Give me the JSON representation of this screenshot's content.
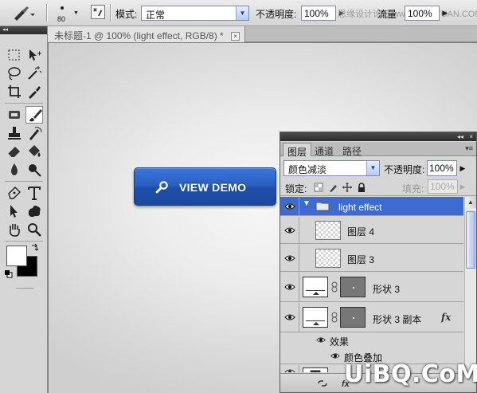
{
  "options_bar": {
    "brush_size": "80",
    "mode_label": "模式:",
    "mode_value": "正常",
    "opacity_label": "不透明度:",
    "opacity_value": "100%",
    "flow_label": "流量",
    "flow_value": "100%",
    "watermark_text": "思缘设计论坛 www.MISSYUAN.COM"
  },
  "toolbox": {
    "collapse_glyph": "◂◂",
    "tools": [
      "rectangular-marquee",
      "move",
      "lasso",
      "magic-wand",
      "crop",
      "eyedropper",
      "healing-brush",
      "brush",
      "clone-stamp",
      "history-brush",
      "eraser",
      "paint-bucket",
      "blur",
      "dodge",
      "pen",
      "type",
      "path-selection",
      "custom-shape",
      "hand",
      "zoom"
    ],
    "foreground_color": "#ffffff",
    "background_color": "#000000"
  },
  "document": {
    "tab_title": "未标题-1 @ 100% (light effect, RGB/8) *",
    "close_glyph": "×",
    "button_label": "VIEW DEMO",
    "button_color": "#2a5fc3"
  },
  "layers_panel": {
    "tabs": [
      "图层",
      "通道",
      "路径"
    ],
    "collapse_glyph": "◂◂",
    "close_glyph": "×",
    "menu_glyph": "▾≡",
    "blend_mode": "颜色减淡",
    "opacity_label": "不透明度:",
    "opacity_value": "100%",
    "lock_label": "锁定:",
    "fill_label": "填充:",
    "fill_value": "100%",
    "selection_color": "#3d6bd0",
    "layers": [
      {
        "name": "light effect",
        "kind": "group",
        "selected": true
      },
      {
        "name": "图层 4",
        "kind": "pixel"
      },
      {
        "name": "图层 3",
        "kind": "pixel"
      },
      {
        "name": "形状 3",
        "kind": "shape"
      },
      {
        "name": "形状 3 副本",
        "kind": "shape",
        "fx": "fx"
      },
      {
        "name": "效果",
        "kind": "effects"
      },
      {
        "name": "颜色叠加",
        "kind": "effect"
      }
    ]
  },
  "watermark": "UiBQ.CoM"
}
